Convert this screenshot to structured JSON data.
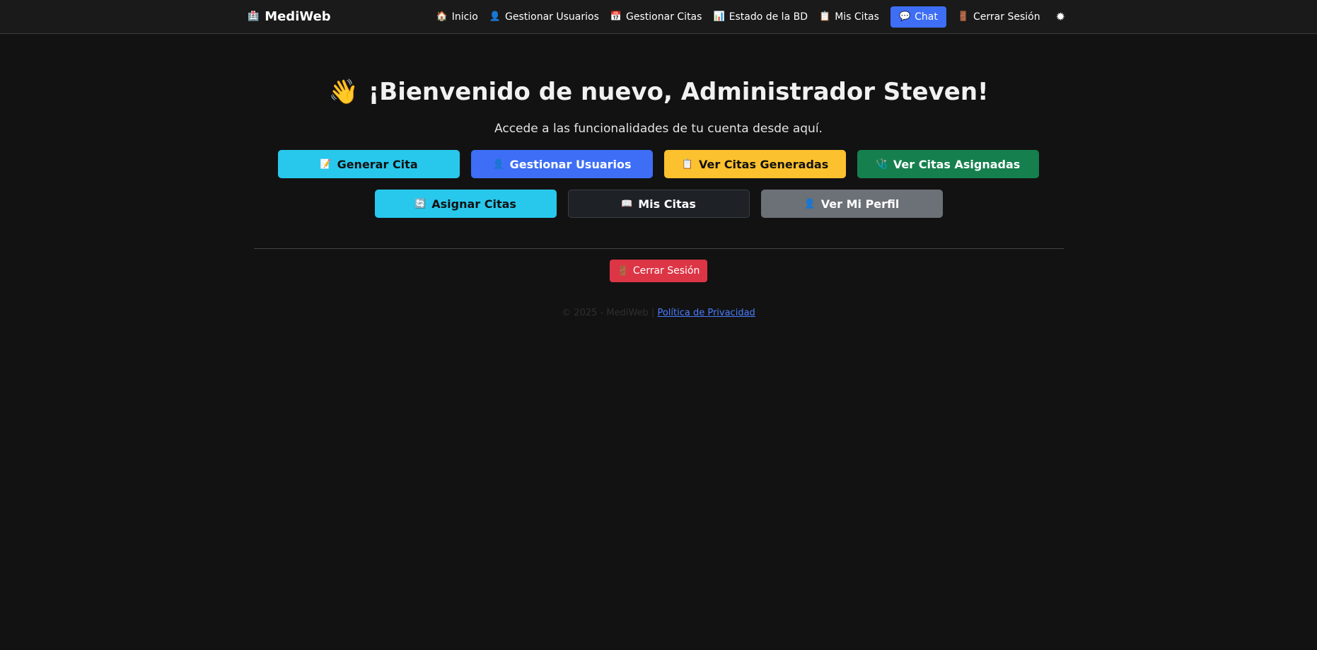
{
  "brand": {
    "icon": "🏥",
    "name": "MediWeb"
  },
  "nav": {
    "items": [
      {
        "icon": "🏠",
        "label": "Inicio"
      },
      {
        "icon": "👤",
        "label": "Gestionar Usuarios"
      },
      {
        "icon": "📅",
        "label": "Gestionar Citas"
      },
      {
        "icon": "📊",
        "label": "Estado de la BD"
      },
      {
        "icon": "📋",
        "label": "Mis Citas"
      },
      {
        "icon": "💬",
        "label": "Chat"
      },
      {
        "icon": "🚪",
        "label": "Cerrar Sesión"
      }
    ],
    "theme_icon": "✹"
  },
  "welcome": {
    "icon": "👋",
    "title": "¡Bienvenido de nuevo, Administrador Steven!",
    "subtitle": "Accede a las funcionalidades de tu cuenta desde aquí."
  },
  "actions": {
    "row1": [
      {
        "icon": "📝",
        "label": "Generar Cita",
        "color": "#28c8ec"
      },
      {
        "icon": "👤",
        "label": "Gestionar Usuarios",
        "color": "#3d6ef5"
      },
      {
        "icon": "📋",
        "label": "Ver Citas Generadas",
        "color": "#fcc12e"
      },
      {
        "icon": "🩺",
        "label": "Ver Citas Asignadas",
        "color": "#15804e"
      }
    ],
    "row2": [
      {
        "icon": "🔄",
        "label": "Asignar Citas",
        "color": "#28c8ec"
      },
      {
        "icon": "📖",
        "label": "Mis Citas",
        "color": "#1e2126"
      },
      {
        "icon": "👤",
        "label": "Ver Mi Perfil",
        "color": "#6b7177"
      }
    ]
  },
  "logout": {
    "icon": "🚪",
    "label": "Cerrar Sesión",
    "color": "#dc3545"
  },
  "footer": {
    "text": "© 2025 - MediWeb | ",
    "link": "Política de Privacidad"
  }
}
